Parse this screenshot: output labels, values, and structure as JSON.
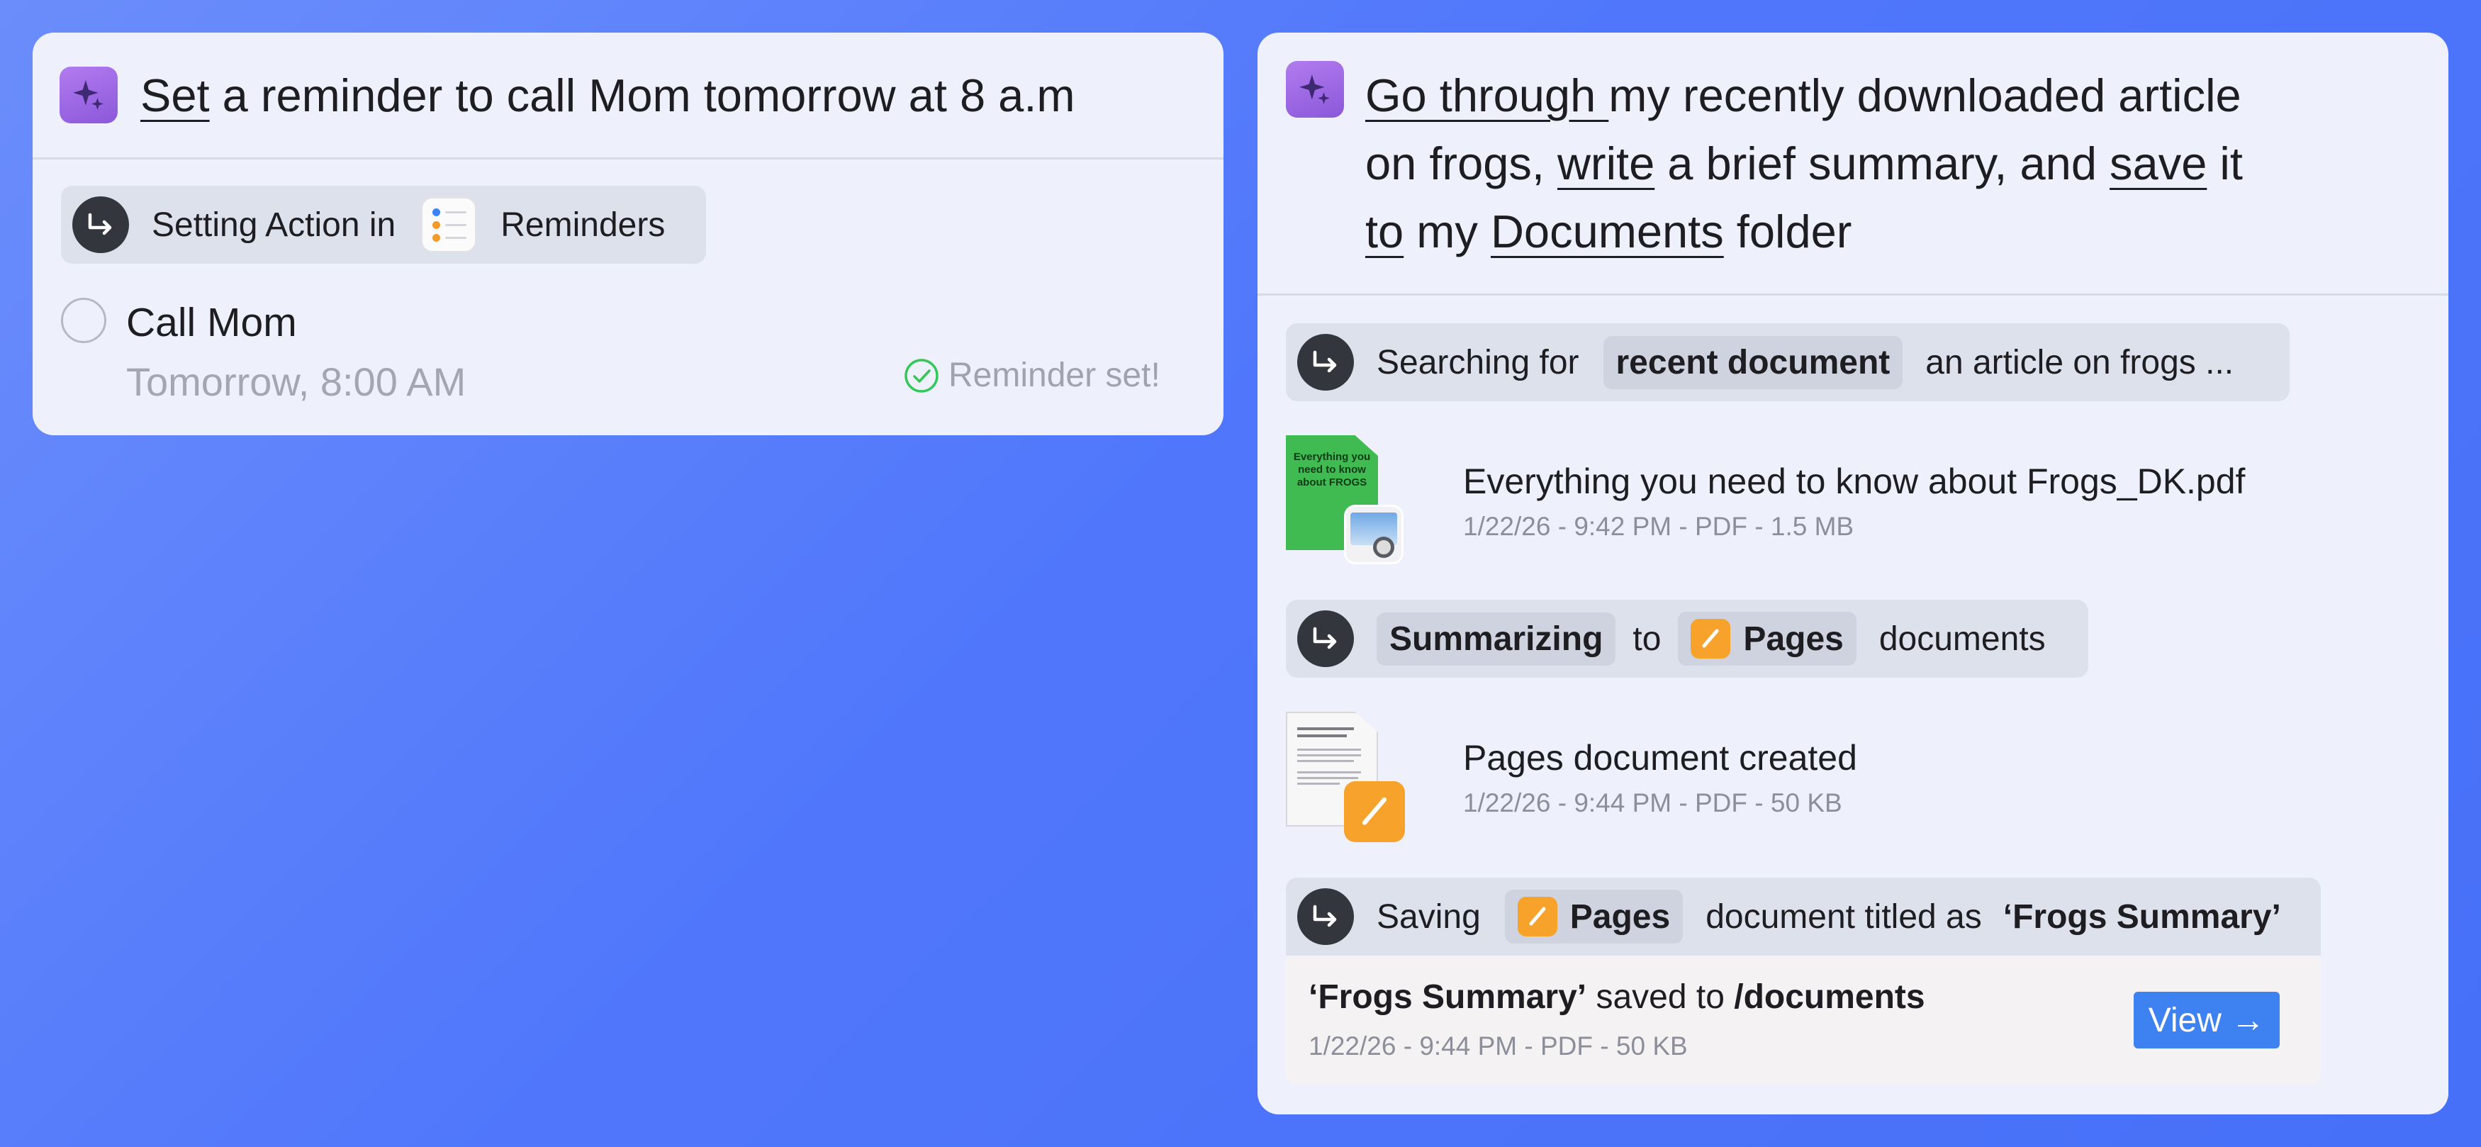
{
  "colors": {
    "background": "#5077fb",
    "card": "#eef1fc",
    "ai_accent": "#9a66e4",
    "chip": "#cfd3df",
    "pages_orange": "#f7a32b",
    "view_button": "#3d82f0",
    "success_green": "#34c759"
  },
  "left_card": {
    "prompt": {
      "word1": "Set",
      "rest": " a reminder to call Mom tomorrow at 8 a.m"
    },
    "step": {
      "prefix": "Setting Action in",
      "app_icon": "reminders-icon",
      "app_name": "Reminders"
    },
    "reminder": {
      "title": "Call Mom",
      "due": "Tomorrow, 8:00 AM",
      "status": "Reminder set!"
    }
  },
  "right_card": {
    "prompt": {
      "p1": "Go through ",
      "p2": "my recently downloaded article",
      "p3": "on frogs, ",
      "p4": "write",
      "p5": " a brief summary, and ",
      "p6": "save",
      "p7": " it",
      "p8": "to",
      "p9": " my ",
      "p10": "Documents",
      "p11": " folder"
    },
    "step_search": {
      "prefix": "Searching for",
      "chip": "recent document",
      "suffix": "an article on frogs ..."
    },
    "file1": {
      "name": "Everything you need to know about Frogs_DK.pdf",
      "meta": "1/22/26 - 9:42 PM - PDF - 1.5 MB",
      "thumb_text": "Everything you need to know about FROGS"
    },
    "step_summarize": {
      "chip": "Summarizing",
      "middle": "to",
      "app_name": "Pages",
      "suffix": "documents"
    },
    "file2": {
      "name": "Pages document created",
      "meta": "1/22/26 - 9:44 PM - PDF - 50 KB"
    },
    "step_save": {
      "prefix": "Saving",
      "app_name": "Pages",
      "middle": "document titled as",
      "title": "‘Frogs Summary’"
    },
    "result": {
      "name": "‘Frogs Summary’",
      "saved_to": " saved to ",
      "path": "/documents",
      "meta": "1/22/26 - 9:44 PM - PDF - 50 KB",
      "view_label": "View →"
    }
  }
}
